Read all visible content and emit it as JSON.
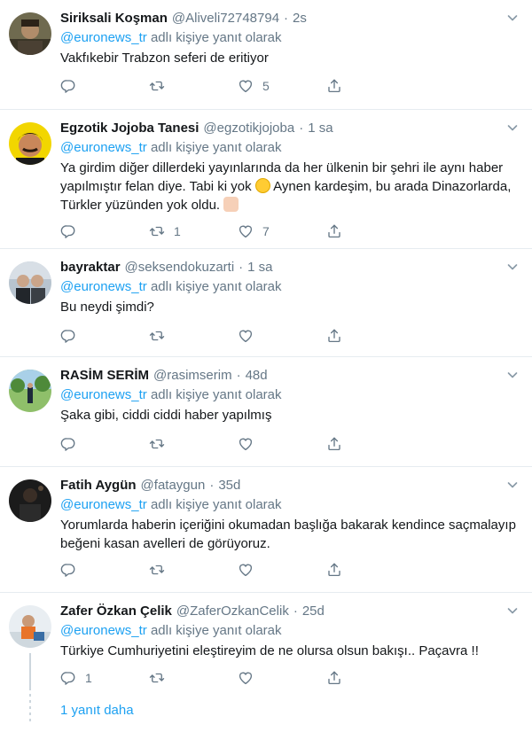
{
  "reply_prefix": "adlı kişiye yanıt olarak",
  "tweets": [
    {
      "name": "Siriksali Koşman",
      "handle": "@Aliveli72748794",
      "time": "2s",
      "reply_to": "@euronews_tr",
      "text": "Vakfıkebir Trabzon seferi de eritiyor",
      "replies": "",
      "retweets": "",
      "likes": "5"
    },
    {
      "name": "Egzotik Jojoba Tanesi",
      "handle": "@egzotikjojoba",
      "time": "1 sa",
      "reply_to": "@euronews_tr",
      "text_part1": "Ya girdim diğer dillerdeki yayınlarında da her ülkenin bir şehri ile aynı haber yapılmıştır felan diye. Tabi ki yok ",
      "text_part2": " Aynen kardeşim, bu arada Dinazorlarda, Türkler yüzünden yok oldu. ",
      "replies": "",
      "retweets": "1",
      "likes": "7"
    },
    {
      "name": "bayraktar",
      "handle": "@seksendokuzarti",
      "time": "1 sa",
      "reply_to": "@euronews_tr",
      "text": "Bu neydi şimdi?",
      "replies": "",
      "retweets": "",
      "likes": ""
    },
    {
      "name": "RASİM SERİM",
      "handle": "@rasimserim",
      "time": "48d",
      "reply_to": "@euronews_tr",
      "text": "Şaka gibi, ciddi ciddi haber yapılmış",
      "replies": "",
      "retweets": "",
      "likes": ""
    },
    {
      "name": "Fatih Aygün",
      "handle": "@fataygun",
      "time": "35d",
      "reply_to": "@euronews_tr",
      "text": "Yorumlarda haberin içeriğini okumadan başlığa bakarak kendince saçmalayıp beğeni kasan avelleri de görüyoruz.",
      "replies": "",
      "retweets": "",
      "likes": ""
    },
    {
      "name": "Zafer Özkan Çelik",
      "handle": "@ZaferOzkanCelik",
      "time": "25d",
      "reply_to": "@euronews_tr",
      "text": "Türkiye Cumhuriyetini eleştireyim de ne olursa olsun bakışı.. Paçavra !!",
      "replies": "1",
      "retweets": "",
      "likes": ""
    }
  ],
  "show_more": "1 yanıt daha",
  "colors": {
    "accent": "#1da1f2",
    "muted": "#657786",
    "text": "#14171a",
    "divider": "#e6ecf0"
  }
}
